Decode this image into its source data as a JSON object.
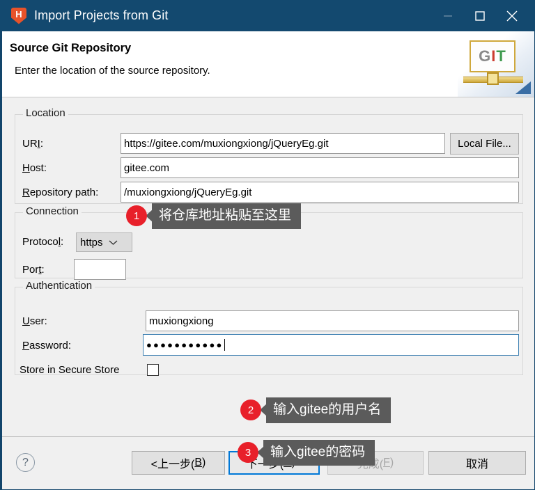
{
  "window": {
    "title": "Import Projects from Git",
    "app_icon": "hbuilder-h-icon",
    "controls": {
      "minimize": "minimize-icon",
      "maximize": "maximize-icon",
      "close": "close-icon"
    },
    "accent_color": "#13496f"
  },
  "header": {
    "title": "Source Git Repository",
    "subtitle": "Enter the location of the source repository.",
    "banner_letters": {
      "g": "G",
      "i": "I",
      "t": "T"
    }
  },
  "location": {
    "group_label": "Location",
    "uri": {
      "label_pre": "UR",
      "label_key": "I",
      "label_post": ":",
      "value": "https://gitee.com/muxiongxiong/jQueryEg.git"
    },
    "host": {
      "label_pre": "",
      "label_key": "H",
      "label_post": "ost:",
      "value": "gitee.com"
    },
    "repo_path": {
      "label_pre": "",
      "label_key": "R",
      "label_post": "epository path:",
      "value": "/muxiongxiong/jQueryEg.git"
    },
    "local_file_button": "Local File..."
  },
  "connection": {
    "group_label": "Connection",
    "protocol": {
      "label_pre": "Protoco",
      "label_key": "l",
      "label_post": ":",
      "value": "https"
    },
    "port": {
      "label_pre": "Por",
      "label_key": "t",
      "label_post": ":",
      "value": ""
    }
  },
  "authentication": {
    "group_label": "Authentication",
    "user": {
      "label_pre": "",
      "label_key": "U",
      "label_post": "ser:",
      "value": "muxiongxiong"
    },
    "password": {
      "label_pre": "",
      "label_key": "P",
      "label_post": "assword:",
      "value": "●●●●●●●●●●●"
    },
    "store_secure": {
      "label": "Store in Secure Store",
      "checked": false
    }
  },
  "annotations": [
    {
      "number": "1",
      "text": "将仓库地址粘贴至这里"
    },
    {
      "number": "2",
      "text": "输入gitee的用户名"
    },
    {
      "number": "3",
      "text": "输入gitee的密码"
    }
  ],
  "footer": {
    "help": "?",
    "back": {
      "pre": "<上一步(",
      "key": "B",
      "post": ")"
    },
    "next": {
      "pre": "下一步(",
      "key": "N",
      "post": ")>"
    },
    "finish": {
      "pre": "完成(",
      "key": "F",
      "post": ")"
    },
    "cancel": {
      "pre": "取消",
      "key": "",
      "post": ""
    }
  }
}
